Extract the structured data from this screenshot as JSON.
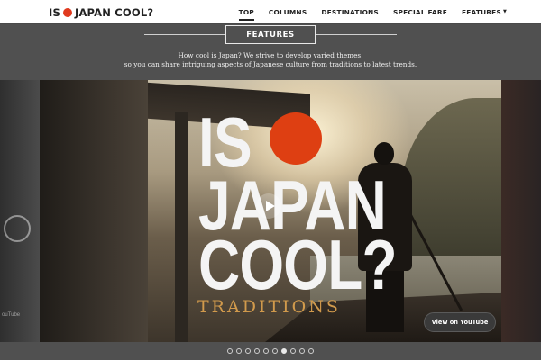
{
  "header": {
    "logo_left": "IS",
    "logo_right": "JAPAN COOL?",
    "logo_dot_color": "#e03a1e",
    "nav": [
      {
        "label": "TOP",
        "active": true
      },
      {
        "label": "COLUMNS",
        "active": false
      },
      {
        "label": "DESTINATIONS",
        "active": false
      },
      {
        "label": "SPECIAL FARE",
        "active": false
      },
      {
        "label": "FEATURES",
        "active": false,
        "has_dropdown": true
      }
    ]
  },
  "features": {
    "heading": "FEATURES",
    "line1": "How cool is Japan? We strive to develop varied themes,",
    "line2": "so you can share intriguing aspects of Japanese culture from traditions to latest trends."
  },
  "slide": {
    "title_line1": "IS",
    "title_line2": "JAPAN",
    "title_line3": "COOL?",
    "subtitle": "TRADITIONS",
    "sun_color": "#de3f12",
    "subtitle_color": "#d19a4c",
    "youtube_button": "View on YouTube",
    "left_peek_text": "ouTube"
  },
  "pager": {
    "count": 10,
    "active_index": 6
  }
}
